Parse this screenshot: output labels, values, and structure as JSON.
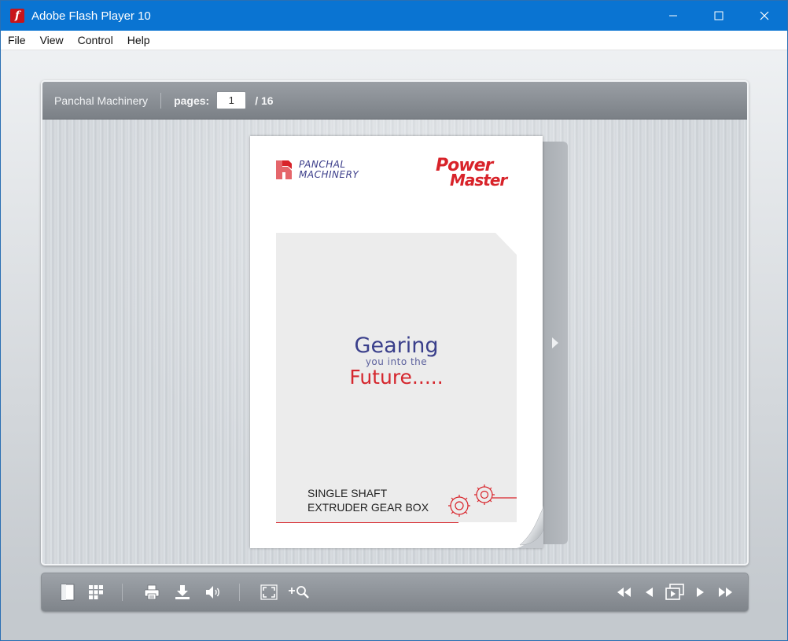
{
  "window": {
    "title": "Adobe Flash Player 10",
    "icon": "flash-icon",
    "controls": [
      "minimize-icon",
      "maximize-icon",
      "close-icon"
    ]
  },
  "menu": {
    "items": [
      "File",
      "View",
      "Control",
      "Help"
    ]
  },
  "viewer": {
    "book_title": "Panchal Machinery",
    "pages_label": "pages:",
    "current_page": "1",
    "total_pages": "/ 16"
  },
  "cover": {
    "logo_left_line1": "PANCHAL",
    "logo_left_line2": "MACHINERY",
    "logo_right_line1": "Power",
    "logo_right_line2": "Master",
    "slogan_line1": "Gearing",
    "slogan_line2": "you into the",
    "slogan_line3": "Future.....",
    "product_line1": "SINGLE SHAFT",
    "product_line2": "EXTRUDER GEAR BOX"
  },
  "toolbar": {
    "left_icons": [
      "single-page-icon",
      "thumbnails-icon",
      "print-icon",
      "download-icon",
      "sound-icon",
      "fullscreen-icon",
      "zoom-in-icon"
    ],
    "right_icons": [
      "first-page-icon",
      "previous-page-icon",
      "two-page-view-icon",
      "next-page-icon",
      "last-page-icon"
    ]
  },
  "colors": {
    "titlebar": "#0a74d2",
    "brand_red": "#d8232a",
    "brand_blue": "#3a3f8b"
  }
}
